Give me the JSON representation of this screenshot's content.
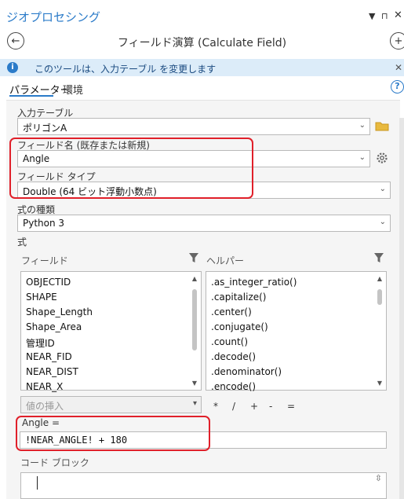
{
  "pane": {
    "title": "ジオプロセシング"
  },
  "tool": {
    "title": "フィールド演算 (Calculate Field)"
  },
  "info": {
    "message": "このツールは、入力テーブル を変更します"
  },
  "tabs": [
    {
      "label": "パラメーター",
      "active": true
    },
    {
      "label": "環境",
      "active": false
    }
  ],
  "params": {
    "input_table": {
      "label": "入力テーブル",
      "value": "ポリゴンA"
    },
    "field_name": {
      "label": "フィールド名 (既存または新規)",
      "value": "Angle"
    },
    "field_type": {
      "label": "フィールド タイプ",
      "value": "Double (64 ビット浮動小数点)"
    },
    "expr_type": {
      "label": "式の種類",
      "value": "Python 3"
    }
  },
  "expression": {
    "label": "式",
    "fields_header": "フィールド",
    "helpers_header": "ヘルパー",
    "fields": [
      "OBJECTID",
      "SHAPE",
      "Shape_Length",
      "Shape_Area",
      "管理ID",
      "NEAR_FID",
      "NEAR_DIST",
      "NEAR_X"
    ],
    "helpers": [
      ".as_integer_ratio()",
      ".capitalize()",
      ".center()",
      ".conjugate()",
      ".count()",
      ".decode()",
      ".denominator()",
      ".encode()"
    ],
    "insert_values_placeholder": "値の挿入",
    "operators": [
      "*",
      "/",
      "+",
      "-",
      "="
    ],
    "target_label": "Angle =",
    "code": "!NEAR_ANGLE!  + 180"
  },
  "code_block": {
    "label": "コード ブロック",
    "value": ""
  },
  "colors": {
    "accent": "#2b7bc9",
    "highlight": "#e0202a",
    "info_bg": "#dcecf9"
  }
}
